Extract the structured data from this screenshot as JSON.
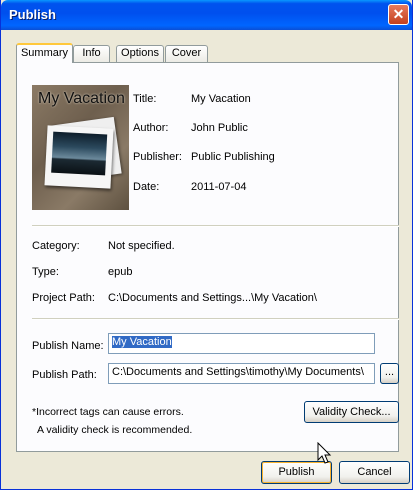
{
  "window": {
    "title": "Publish",
    "close_glyph": "✕"
  },
  "tabs": [
    {
      "label": "Summary",
      "active": true
    },
    {
      "label": "Info",
      "active": false
    },
    {
      "label": "Options",
      "active": false
    },
    {
      "label": "Cover",
      "active": false
    }
  ],
  "book": {
    "cover_title": "My Vacation",
    "title_label": "Title:",
    "title_value": "My Vacation",
    "author_label": "Author:",
    "author_value": "John Public",
    "publisher_label": "Publisher:",
    "publisher_value": "Public Publishing",
    "date_label": "Date:",
    "date_value": "2011-07-04"
  },
  "details": {
    "category_label": "Category:",
    "category_value": "Not specified.",
    "type_label": "Type:",
    "type_value": "epub",
    "project_path_label": "Project Path:",
    "project_path_value": "C:\\Documents and Settings...\\My Vacation\\"
  },
  "publish": {
    "name_label": "Publish Name:",
    "name_value": "My Vacation",
    "path_label": "Publish Path:",
    "path_value": "C:\\Documents and Settings\\timothy\\My Documents\\",
    "browse_label": "..."
  },
  "notes": {
    "line1": "*Incorrect tags can cause errors.",
    "line2": "A validity check is recommended."
  },
  "buttons": {
    "validity": "Validity Check...",
    "publish": "Publish",
    "cancel": "Cancel"
  }
}
